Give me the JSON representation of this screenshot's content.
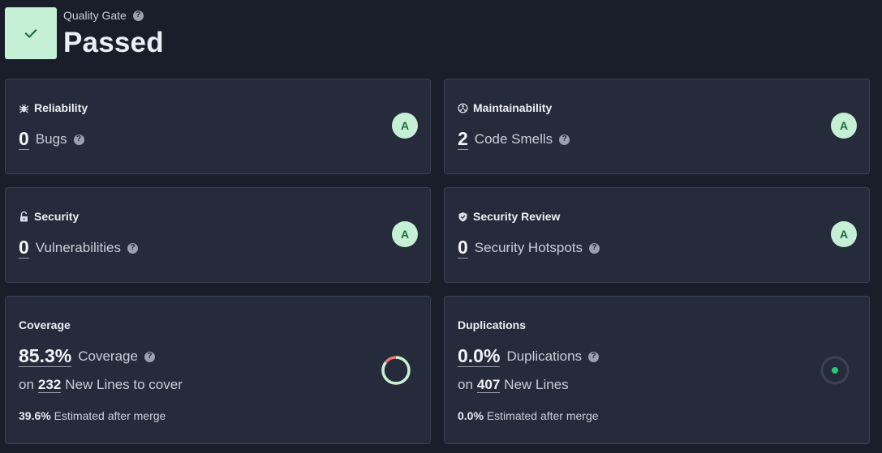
{
  "quality_gate": {
    "label": "Quality Gate",
    "status": "Passed",
    "check_icon": "check-icon",
    "status_color": "#c6f0d6"
  },
  "reliability": {
    "title": "Reliability",
    "icon": "bug-icon",
    "value": "0",
    "unit": "Bugs",
    "rating": "A"
  },
  "maintainability": {
    "title": "Maintainability",
    "icon": "maintainability-icon",
    "value": "2",
    "unit": "Code Smells",
    "rating": "A"
  },
  "security": {
    "title": "Security",
    "icon": "lock-icon",
    "value": "0",
    "unit": "Vulnerabilities",
    "rating": "A"
  },
  "security_review": {
    "title": "Security Review",
    "icon": "shield-icon",
    "value": "0",
    "unit": "Security Hotspots",
    "rating": "A"
  },
  "coverage": {
    "title": "Coverage",
    "value": "85.3%",
    "unit": "Coverage",
    "on_prefix": "on",
    "lines_count": "232",
    "lines_label": "New Lines to cover",
    "estimate_value": "39.6%",
    "estimate_label": "Estimated after merge",
    "fraction": 0.853
  },
  "duplications": {
    "title": "Duplications",
    "value": "0.0%",
    "unit": "Duplications",
    "on_prefix": "on",
    "lines_count": "407",
    "lines_label": "New Lines",
    "estimate_value": "0.0%",
    "estimate_label": "Estimated after merge",
    "fraction": 0.0
  },
  "colors": {
    "background": "#1a1d2a",
    "card": "#262b3b",
    "rating_a_bg": "#c6f0d6",
    "rating_a_text": "#1e6b3d",
    "coverage_good": "#c6f0d6",
    "coverage_bad": "#e87979",
    "duplication_dot": "#2ec66d"
  },
  "help_symbol": "?"
}
